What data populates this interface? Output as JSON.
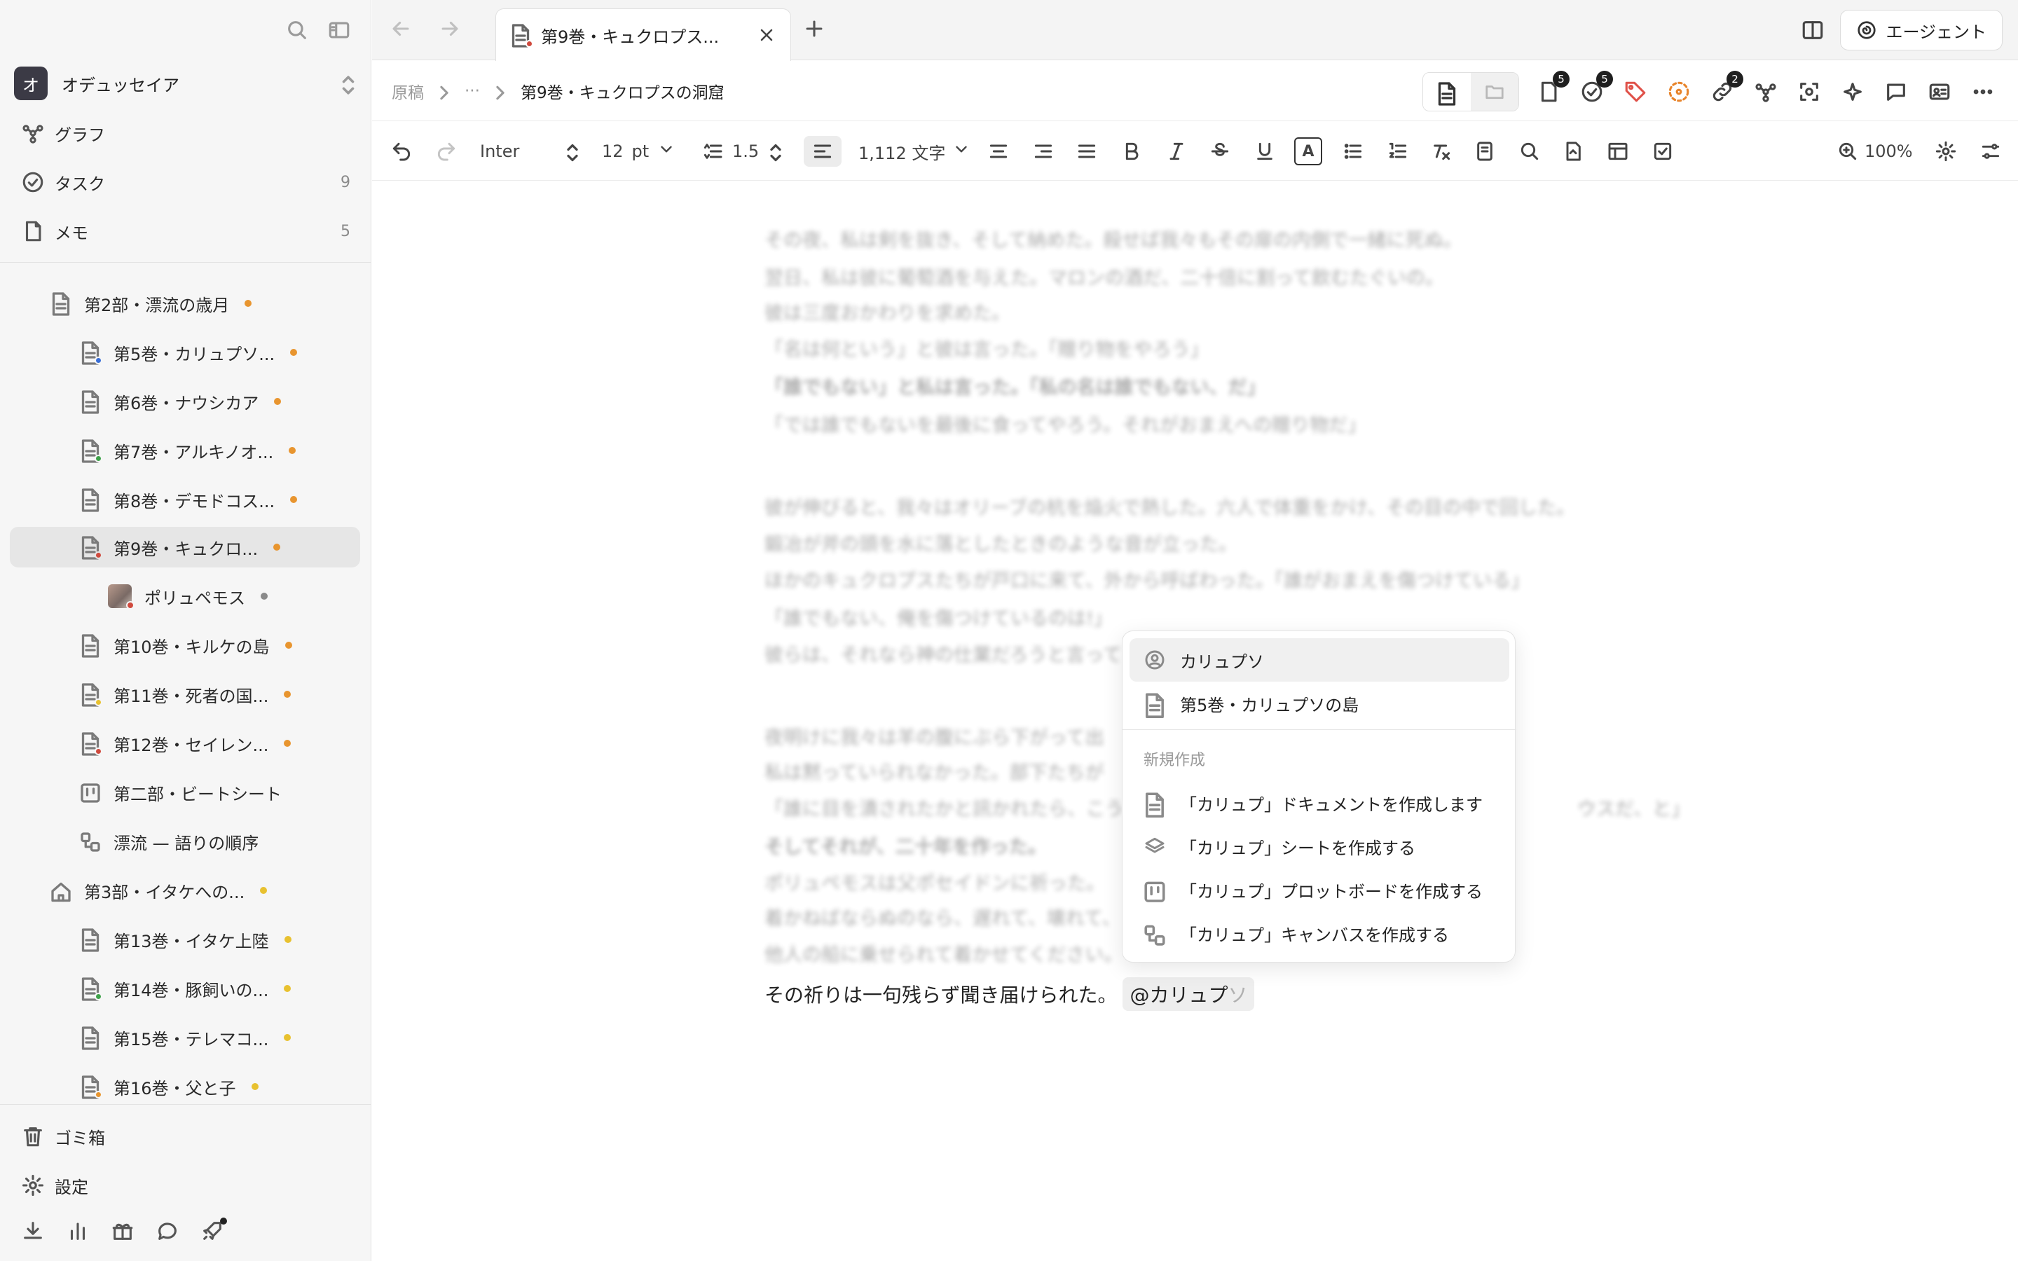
{
  "workspace": {
    "badge": "オ",
    "name": "オデュッセイア"
  },
  "nav": [
    {
      "label": "グラフ",
      "count": ""
    },
    {
      "label": "タスク",
      "count": "9"
    },
    {
      "label": "メモ",
      "count": "5"
    }
  ],
  "tree": [
    {
      "label": "第2部・漂流の歳月",
      "dot": "#e8952f",
      "status": ""
    },
    {
      "label": "第5巻・カリュプソ...",
      "dot": "#e8952f",
      "status": "#3a6fd8"
    },
    {
      "label": "第6巻・ナウシカア",
      "dot": "#e8952f",
      "status": ""
    },
    {
      "label": "第7巻・アルキノオ...",
      "dot": "#e8952f",
      "status": "#3fa24a"
    },
    {
      "label": "第8巻・デモドコス...",
      "dot": "#e8952f",
      "status": ""
    },
    {
      "label": "第9巻・キュクロ...",
      "dot": "#e8952f",
      "status": "#d04a3e"
    },
    {
      "label": "ポリュペモス",
      "dot": "#8a8a8a",
      "status": ""
    },
    {
      "label": "第10巻・キルケの島",
      "dot": "#e8952f",
      "status": ""
    },
    {
      "label": "第11巻・死者の国...",
      "dot": "#e8952f",
      "status": "#e8c12f"
    },
    {
      "label": "第12巻・セイレン...",
      "dot": "#e8952f",
      "status": "#d04a3e"
    },
    {
      "label": "第二部・ビートシート",
      "dot": "",
      "status": ""
    },
    {
      "label": "漂流 — 語りの順序",
      "dot": "",
      "status": ""
    },
    {
      "label": "第3部・イタケへの...",
      "dot": "#e8c12f",
      "status": ""
    },
    {
      "label": "第13巻・イタケ上陸",
      "dot": "#e8c12f",
      "status": ""
    },
    {
      "label": "第14巻・豚飼いの...",
      "dot": "#e8c12f",
      "status": "#3fa24a"
    },
    {
      "label": "第15巻・テレマコ...",
      "dot": "#e8c12f",
      "status": ""
    },
    {
      "label": "第16巻・父と子",
      "dot": "#e8c12f",
      "status": "#e8952f"
    }
  ],
  "sidebar_bottom": [
    {
      "label": "ゴミ箱"
    },
    {
      "label": "設定"
    }
  ],
  "tab": {
    "title": "第9巻・キュクロプス..."
  },
  "agent_button": "エージェント",
  "breadcrumb": {
    "root": "原稿",
    "ellipsis": "···",
    "current": "第9巻・キュクロプスの洞窟"
  },
  "badges": {
    "pages": "5",
    "tasks": "5",
    "links": "2"
  },
  "toolbar": {
    "font": "Inter",
    "size": "12",
    "unit": "pt",
    "line_height": "1.5",
    "word_count": "1,112 文字",
    "color_letter": "A",
    "zoom": "100%"
  },
  "editor": {
    "blurred_lines": [
      "その夜、私は剣を抜き、そして納めた。殺せば我々もその扉の内側で一緒に死ぬ。",
      "翌日、私は彼に葡萄酒を与えた。マロンの酒だ、二十倍に割って飲むたぐいの。",
      "彼は三度おかわりを求めた。",
      "「名は何という」と彼は言った。「贈り物をやろう」",
      "「誰でもない」と私は言った。「私の名は誰でもない、だ」",
      "「では誰でもないを最後に食ってやろう。それがおまえへの贈り物だ」",
      "彼が伸びると、我々はオリーブの杭を焔火で熱した。六人で体重をかけ、その目の中で回した。",
      "鍛冶が斧の頭を水に落としたときのような音が立った。",
      "ほかのキュクロプスたちが戸口に来て、外から呼ばわった。「誰がおまえを傷つけている」",
      "「誰でもない、俺を傷つけているのは!」",
      "彼らは、それなら神の仕業だろうと言って",
      "夜明けに我々は羊の腹にぶら下がって出",
      "私は黙っていられなかった。部下たちが",
      "「誰に目を潰されたかと訊かれたら、こう",
      "ウスだ、と」",
      "そしてそれが、二十年を作った。",
      "ポリュペモスは父ポセイドンに祈った。",
      "着かねばならぬのなら、遅れて、壊れて、",
      "他人の船に乗せられて着かせてください。"
    ],
    "final_line": "その祈りは一句残らず聞き届けられた。",
    "mention_typed": "@カリュプ",
    "mention_ghost": "ソ"
  },
  "popup": {
    "results": [
      {
        "label": "カリュプソ",
        "icon": "person-icon"
      },
      {
        "label": "第5巻・カリュプソの島",
        "icon": "document-icon"
      }
    ],
    "section": "新規作成",
    "create": [
      {
        "label": "「カリュプ」ドキュメントを作成します",
        "icon": "document-icon"
      },
      {
        "label": "「カリュプ」シートを作成する",
        "icon": "layers-icon"
      },
      {
        "label": "「カリュプ」プロットボードを作成する",
        "icon": "board-icon"
      },
      {
        "label": "「カリュプ」キャンバスを作成する",
        "icon": "canvas-icon"
      }
    ]
  }
}
